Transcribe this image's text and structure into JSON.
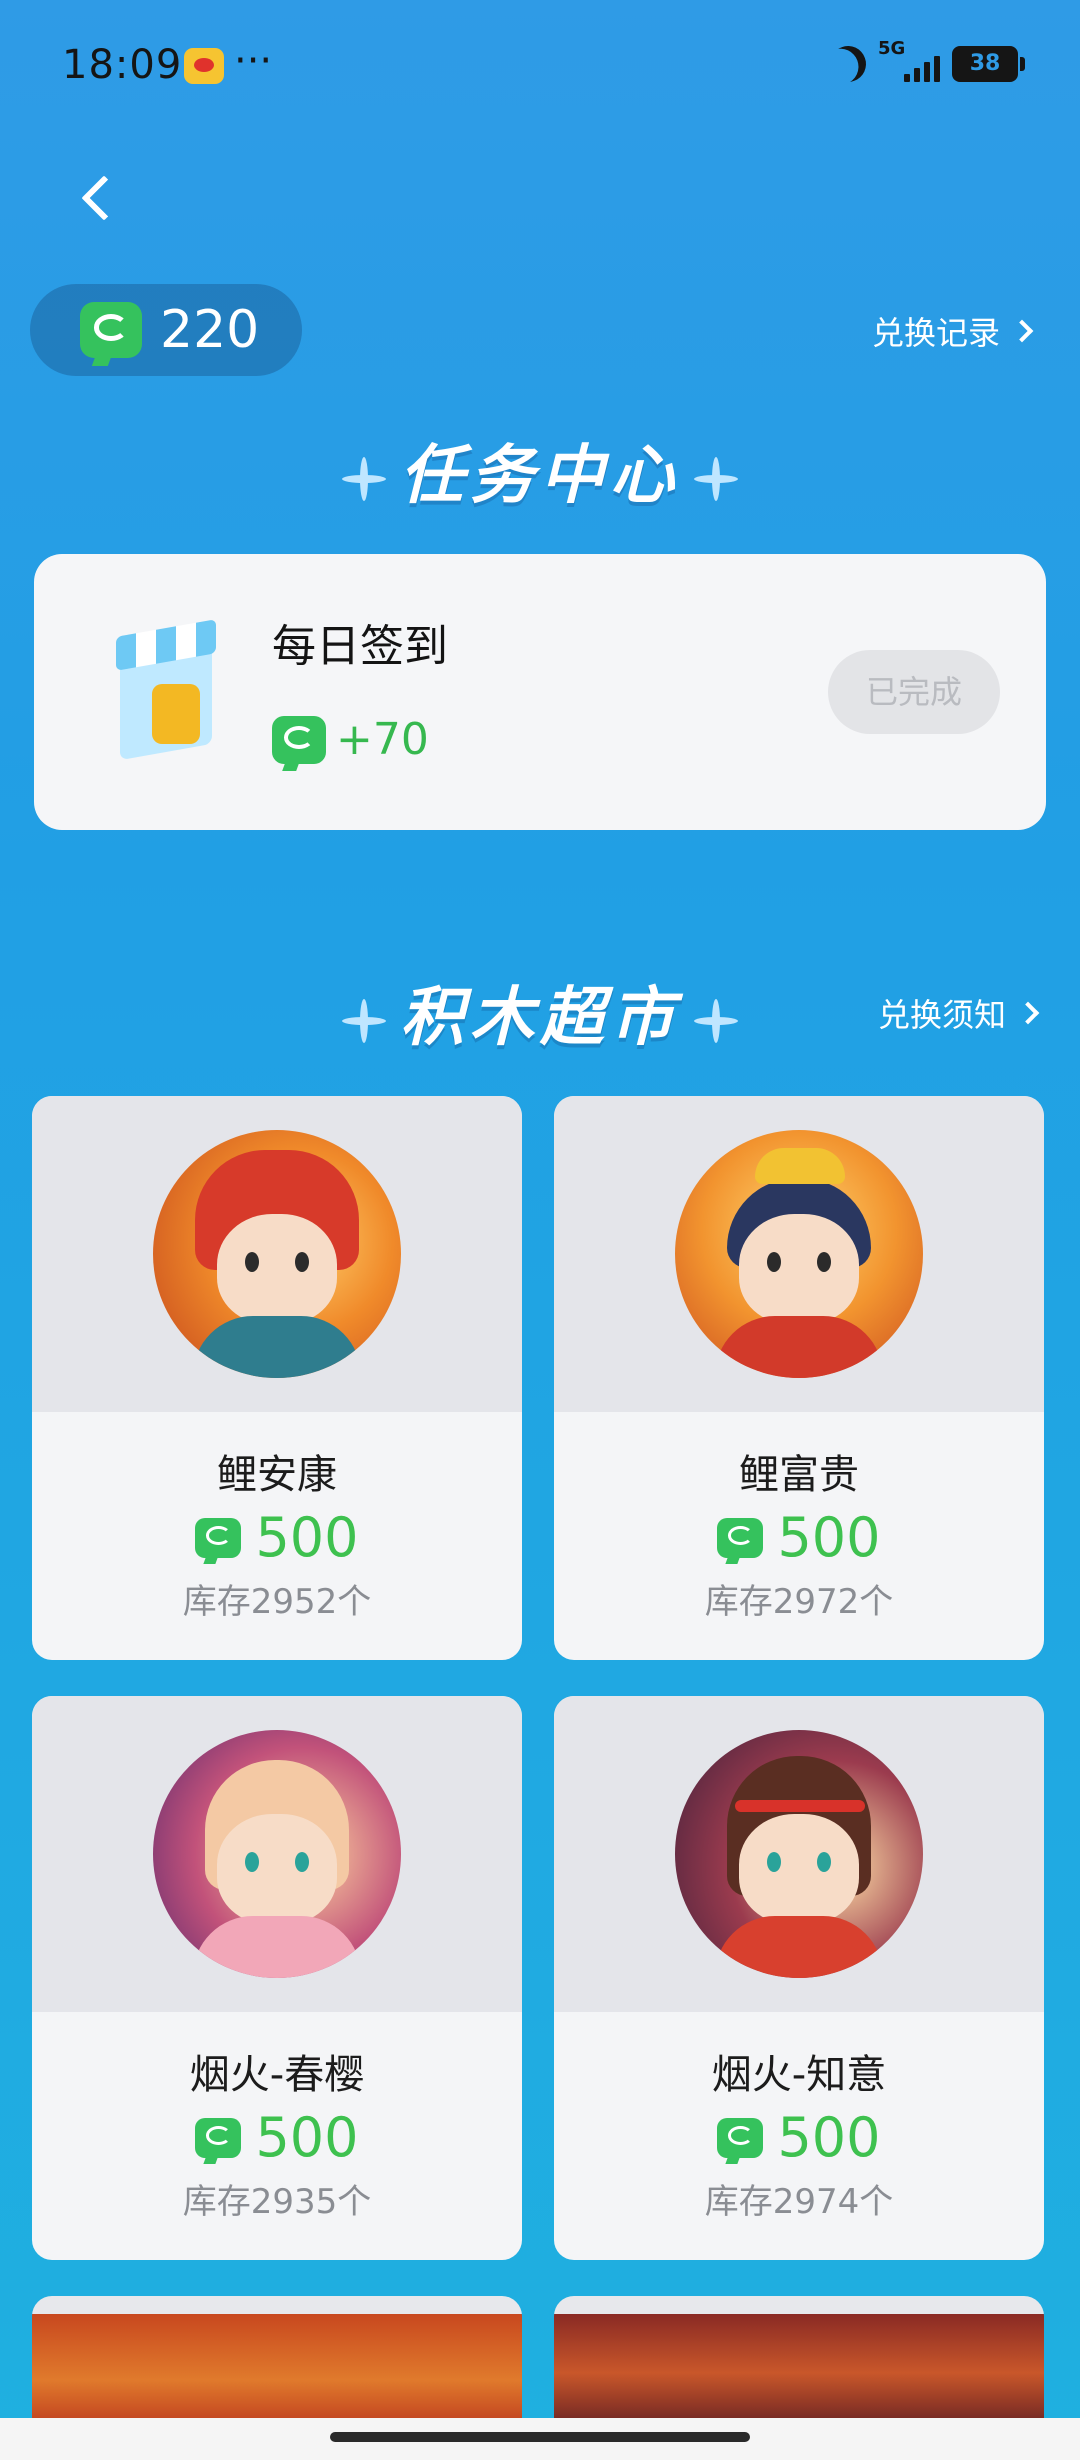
{
  "status_bar": {
    "time": "18:09",
    "more": "···",
    "network": "5G",
    "battery": "38"
  },
  "points": {
    "balance": "220"
  },
  "exchange_record_link": "兑换记录",
  "task_section": {
    "title": "任务中心",
    "tasks": [
      {
        "name": "每日签到",
        "reward": "+70",
        "button": "已完成"
      }
    ]
  },
  "shop_section": {
    "title": "积木超市",
    "rules_link": "兑换须知",
    "products": [
      {
        "name": "鲤安康",
        "price": "500",
        "stock": "库存2952个"
      },
      {
        "name": "鲤富贵",
        "price": "500",
        "stock": "库存2972个"
      },
      {
        "name": "烟火-春樱",
        "price": "500",
        "stock": "库存2935个"
      },
      {
        "name": "烟火-知意",
        "price": "500",
        "stock": "库存2974个"
      }
    ]
  },
  "colors": {
    "background_top": "#2f9be6",
    "background_bottom": "#1fb0e0",
    "coin_green": "#35c25d",
    "price_green": "#3ec14f",
    "card_bg": "#f4f5f7"
  },
  "icons": {
    "back": "chevron-left-icon",
    "coin": "green-c-coin-icon",
    "chevron": "chevron-right-icon",
    "sparkle": "sparkle-icon"
  }
}
